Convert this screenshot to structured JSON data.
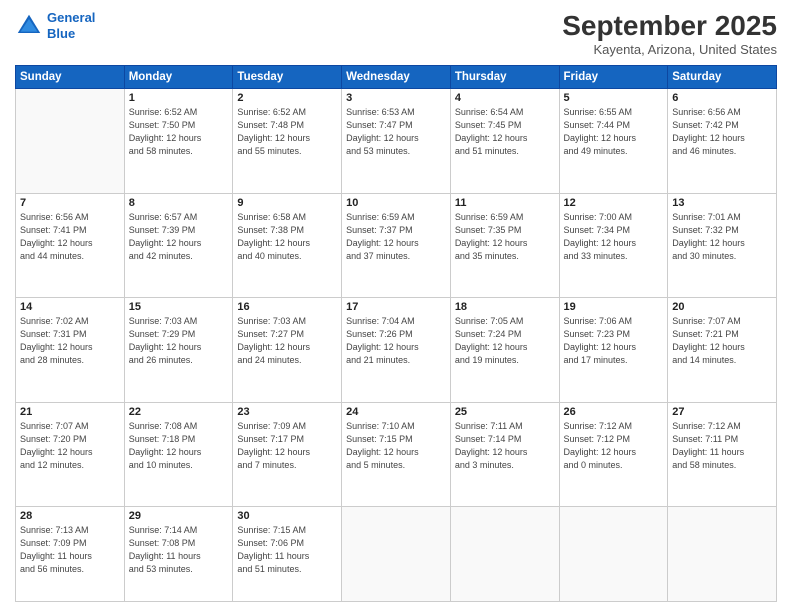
{
  "header": {
    "logo_line1": "General",
    "logo_line2": "Blue",
    "month": "September 2025",
    "location": "Kayenta, Arizona, United States"
  },
  "weekdays": [
    "Sunday",
    "Monday",
    "Tuesday",
    "Wednesday",
    "Thursday",
    "Friday",
    "Saturday"
  ],
  "weeks": [
    [
      {
        "day": "",
        "info": ""
      },
      {
        "day": "1",
        "info": "Sunrise: 6:52 AM\nSunset: 7:50 PM\nDaylight: 12 hours\nand 58 minutes."
      },
      {
        "day": "2",
        "info": "Sunrise: 6:52 AM\nSunset: 7:48 PM\nDaylight: 12 hours\nand 55 minutes."
      },
      {
        "day": "3",
        "info": "Sunrise: 6:53 AM\nSunset: 7:47 PM\nDaylight: 12 hours\nand 53 minutes."
      },
      {
        "day": "4",
        "info": "Sunrise: 6:54 AM\nSunset: 7:45 PM\nDaylight: 12 hours\nand 51 minutes."
      },
      {
        "day": "5",
        "info": "Sunrise: 6:55 AM\nSunset: 7:44 PM\nDaylight: 12 hours\nand 49 minutes."
      },
      {
        "day": "6",
        "info": "Sunrise: 6:56 AM\nSunset: 7:42 PM\nDaylight: 12 hours\nand 46 minutes."
      }
    ],
    [
      {
        "day": "7",
        "info": "Sunrise: 6:56 AM\nSunset: 7:41 PM\nDaylight: 12 hours\nand 44 minutes."
      },
      {
        "day": "8",
        "info": "Sunrise: 6:57 AM\nSunset: 7:39 PM\nDaylight: 12 hours\nand 42 minutes."
      },
      {
        "day": "9",
        "info": "Sunrise: 6:58 AM\nSunset: 7:38 PM\nDaylight: 12 hours\nand 40 minutes."
      },
      {
        "day": "10",
        "info": "Sunrise: 6:59 AM\nSunset: 7:37 PM\nDaylight: 12 hours\nand 37 minutes."
      },
      {
        "day": "11",
        "info": "Sunrise: 6:59 AM\nSunset: 7:35 PM\nDaylight: 12 hours\nand 35 minutes."
      },
      {
        "day": "12",
        "info": "Sunrise: 7:00 AM\nSunset: 7:34 PM\nDaylight: 12 hours\nand 33 minutes."
      },
      {
        "day": "13",
        "info": "Sunrise: 7:01 AM\nSunset: 7:32 PM\nDaylight: 12 hours\nand 30 minutes."
      }
    ],
    [
      {
        "day": "14",
        "info": "Sunrise: 7:02 AM\nSunset: 7:31 PM\nDaylight: 12 hours\nand 28 minutes."
      },
      {
        "day": "15",
        "info": "Sunrise: 7:03 AM\nSunset: 7:29 PM\nDaylight: 12 hours\nand 26 minutes."
      },
      {
        "day": "16",
        "info": "Sunrise: 7:03 AM\nSunset: 7:27 PM\nDaylight: 12 hours\nand 24 minutes."
      },
      {
        "day": "17",
        "info": "Sunrise: 7:04 AM\nSunset: 7:26 PM\nDaylight: 12 hours\nand 21 minutes."
      },
      {
        "day": "18",
        "info": "Sunrise: 7:05 AM\nSunset: 7:24 PM\nDaylight: 12 hours\nand 19 minutes."
      },
      {
        "day": "19",
        "info": "Sunrise: 7:06 AM\nSunset: 7:23 PM\nDaylight: 12 hours\nand 17 minutes."
      },
      {
        "day": "20",
        "info": "Sunrise: 7:07 AM\nSunset: 7:21 PM\nDaylight: 12 hours\nand 14 minutes."
      }
    ],
    [
      {
        "day": "21",
        "info": "Sunrise: 7:07 AM\nSunset: 7:20 PM\nDaylight: 12 hours\nand 12 minutes."
      },
      {
        "day": "22",
        "info": "Sunrise: 7:08 AM\nSunset: 7:18 PM\nDaylight: 12 hours\nand 10 minutes."
      },
      {
        "day": "23",
        "info": "Sunrise: 7:09 AM\nSunset: 7:17 PM\nDaylight: 12 hours\nand 7 minutes."
      },
      {
        "day": "24",
        "info": "Sunrise: 7:10 AM\nSunset: 7:15 PM\nDaylight: 12 hours\nand 5 minutes."
      },
      {
        "day": "25",
        "info": "Sunrise: 7:11 AM\nSunset: 7:14 PM\nDaylight: 12 hours\nand 3 minutes."
      },
      {
        "day": "26",
        "info": "Sunrise: 7:12 AM\nSunset: 7:12 PM\nDaylight: 12 hours\nand 0 minutes."
      },
      {
        "day": "27",
        "info": "Sunrise: 7:12 AM\nSunset: 7:11 PM\nDaylight: 11 hours\nand 58 minutes."
      }
    ],
    [
      {
        "day": "28",
        "info": "Sunrise: 7:13 AM\nSunset: 7:09 PM\nDaylight: 11 hours\nand 56 minutes."
      },
      {
        "day": "29",
        "info": "Sunrise: 7:14 AM\nSunset: 7:08 PM\nDaylight: 11 hours\nand 53 minutes."
      },
      {
        "day": "30",
        "info": "Sunrise: 7:15 AM\nSunset: 7:06 PM\nDaylight: 11 hours\nand 51 minutes."
      },
      {
        "day": "",
        "info": ""
      },
      {
        "day": "",
        "info": ""
      },
      {
        "day": "",
        "info": ""
      },
      {
        "day": "",
        "info": ""
      }
    ]
  ]
}
